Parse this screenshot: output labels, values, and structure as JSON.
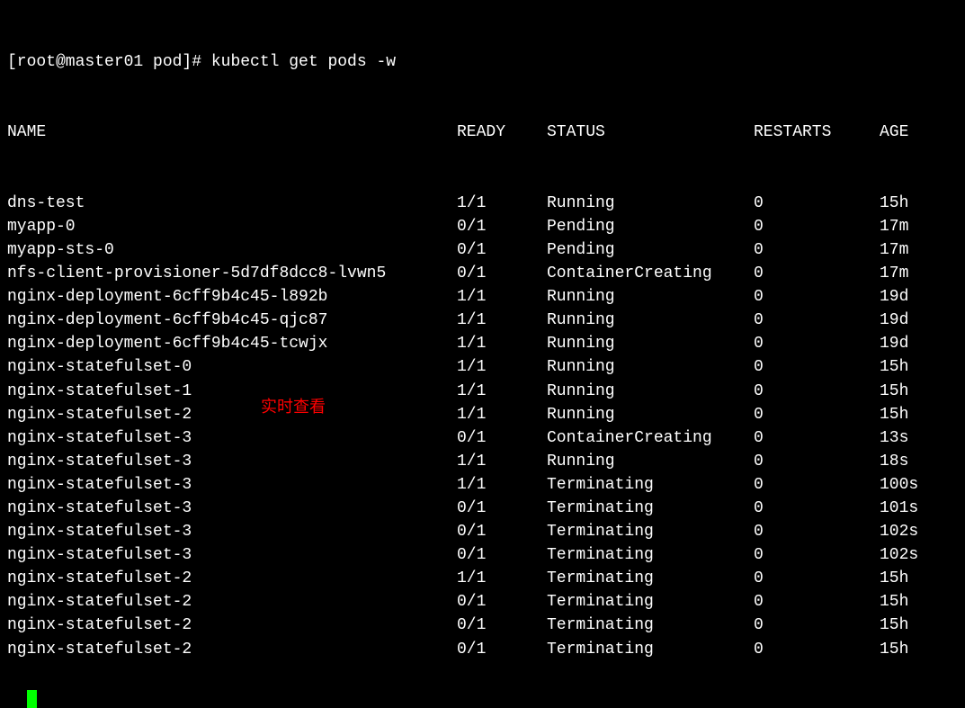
{
  "prompt": "[root@master01 pod]# kubectl get pods -w",
  "headers": {
    "name": "NAME",
    "ready": "READY",
    "status": "STATUS",
    "restarts": "RESTARTS",
    "age": "AGE"
  },
  "rows": [
    {
      "name": "dns-test",
      "ready": "1/1",
      "status": "Running",
      "restarts": "0",
      "age": "15h"
    },
    {
      "name": "myapp-0",
      "ready": "0/1",
      "status": "Pending",
      "restarts": "0",
      "age": "17m"
    },
    {
      "name": "myapp-sts-0",
      "ready": "0/1",
      "status": "Pending",
      "restarts": "0",
      "age": "17m"
    },
    {
      "name": "nfs-client-provisioner-5d7df8dcc8-lvwn5",
      "ready": "0/1",
      "status": "ContainerCreating",
      "restarts": "0",
      "age": "17m"
    },
    {
      "name": "nginx-deployment-6cff9b4c45-l892b",
      "ready": "1/1",
      "status": "Running",
      "restarts": "0",
      "age": "19d"
    },
    {
      "name": "nginx-deployment-6cff9b4c45-qjc87",
      "ready": "1/1",
      "status": "Running",
      "restarts": "0",
      "age": "19d"
    },
    {
      "name": "nginx-deployment-6cff9b4c45-tcwjx",
      "ready": "1/1",
      "status": "Running",
      "restarts": "0",
      "age": "19d"
    },
    {
      "name": "nginx-statefulset-0",
      "ready": "1/1",
      "status": "Running",
      "restarts": "0",
      "age": "15h"
    },
    {
      "name": "nginx-statefulset-1",
      "ready": "1/1",
      "status": "Running",
      "restarts": "0",
      "age": "15h"
    },
    {
      "name": "nginx-statefulset-2",
      "ready": "1/1",
      "status": "Running",
      "restarts": "0",
      "age": "15h"
    },
    {
      "name": "nginx-statefulset-3",
      "ready": "0/1",
      "status": "ContainerCreating",
      "restarts": "0",
      "age": "13s"
    },
    {
      "name": "nginx-statefulset-3",
      "ready": "1/1",
      "status": "Running",
      "restarts": "0",
      "age": "18s"
    },
    {
      "name": "nginx-statefulset-3",
      "ready": "1/1",
      "status": "Terminating",
      "restarts": "0",
      "age": "100s"
    },
    {
      "name": "nginx-statefulset-3",
      "ready": "0/1",
      "status": "Terminating",
      "restarts": "0",
      "age": "101s"
    },
    {
      "name": "nginx-statefulset-3",
      "ready": "0/1",
      "status": "Terminating",
      "restarts": "0",
      "age": "102s"
    },
    {
      "name": "nginx-statefulset-3",
      "ready": "0/1",
      "status": "Terminating",
      "restarts": "0",
      "age": "102s"
    },
    {
      "name": "nginx-statefulset-2",
      "ready": "1/1",
      "status": "Terminating",
      "restarts": "0",
      "age": "15h"
    },
    {
      "name": "nginx-statefulset-2",
      "ready": "0/1",
      "status": "Terminating",
      "restarts": "0",
      "age": "15h"
    },
    {
      "name": "nginx-statefulset-2",
      "ready": "0/1",
      "status": "Terminating",
      "restarts": "0",
      "age": "15h"
    },
    {
      "name": "nginx-statefulset-2",
      "ready": "0/1",
      "status": "Terminating",
      "restarts": "0",
      "age": "15h"
    }
  ],
  "annotation": "实时查看"
}
